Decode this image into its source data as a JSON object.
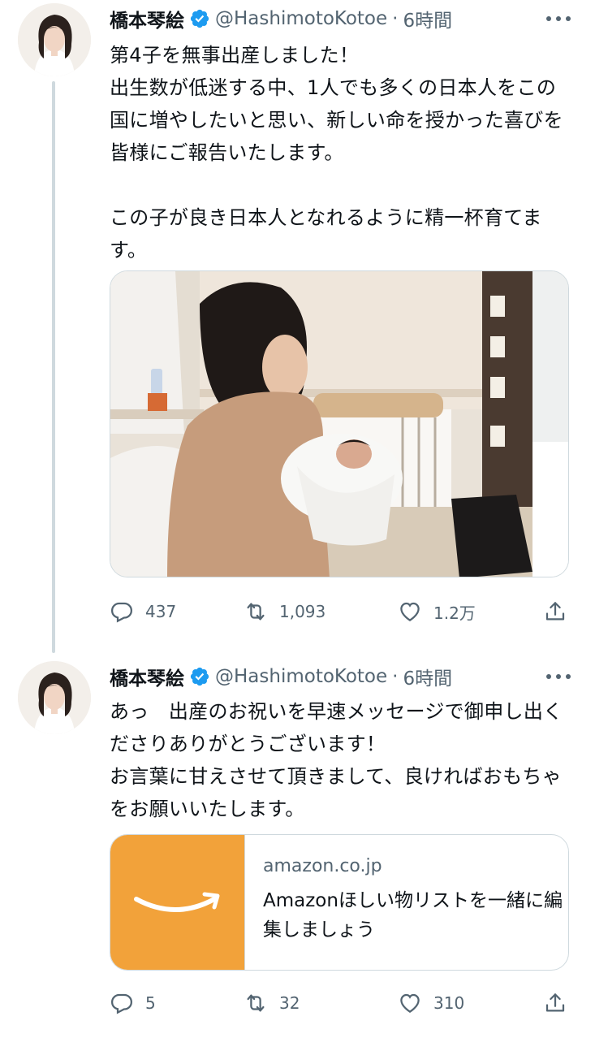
{
  "tweets": [
    {
      "display_name": "橋本琴絵",
      "handle": "@HashimotoKotoe",
      "separator": "·",
      "time": "6時間",
      "text": "第4子を無事出産しました！\n出生数が低迷する中、1人でも多くの日本人をこの国に増やしたいと思い、新しい命を授かった喜びを皆様にご報告いたします。\n\nこの子が良き日本人となれるように精一杯育てます。",
      "stats": {
        "replies": "437",
        "retweets": "1,093",
        "likes": "1.2万"
      }
    },
    {
      "display_name": "橋本琴絵",
      "handle": "@HashimotoKotoe",
      "separator": "·",
      "time": "6時間",
      "text": "あっ　出産のお祝いを早速メッセージで御申し出くださりありがとうございます！\nお言葉に甘えさせて頂きまして、良ければおもちゃをお願いいたします。",
      "card": {
        "domain": "amazon.co.jp",
        "title": "Amazonほしい物リストを一緒に編集しましょう"
      },
      "stats": {
        "replies": "5",
        "retweets": "32",
        "likes": "310"
      }
    }
  ],
  "colors": {
    "text": "#0f1419",
    "secondary": "#536471",
    "verified": "#1d9bf0",
    "border": "#cfd9de",
    "amazon_orange": "#f2a23a"
  },
  "icons": {
    "verified": "verified-badge-icon",
    "more": "more-dots-icon",
    "reply": "reply-bubble-icon",
    "retweet": "retweet-arrows-icon",
    "like": "heart-icon",
    "share": "share-upload-icon"
  }
}
